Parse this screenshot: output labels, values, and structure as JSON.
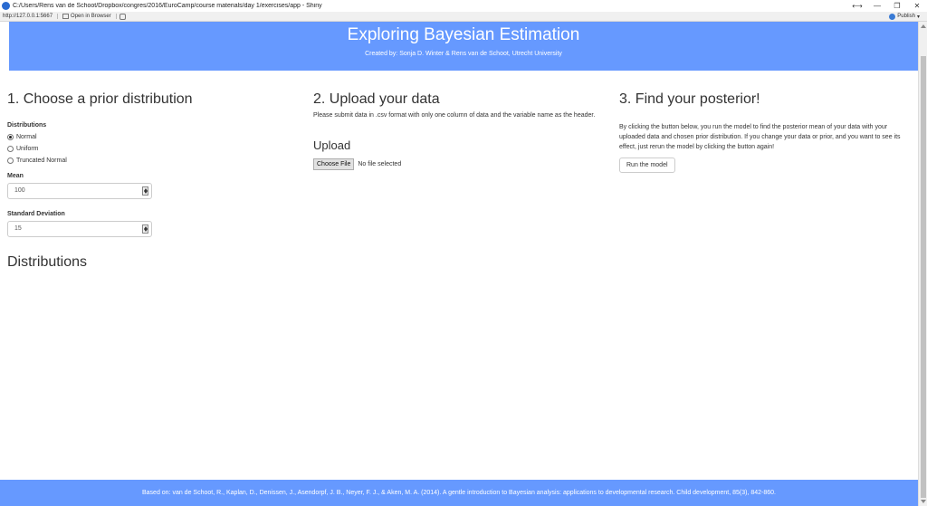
{
  "window": {
    "title": "C:/Users/Rens van de Schoot/Dropbox/congres/2016/EuroCamp/course materials/day 1/exercises/app - Shiny",
    "controls": [
      "⟷",
      "—",
      "❐",
      "✕"
    ]
  },
  "toolbar": {
    "url": "http://127.0.0.1:5667",
    "open_in_browser": "Open in Browser",
    "publish": "Publish",
    "publish_caret": "▾"
  },
  "header": {
    "title": "Exploring Bayesian Estimation",
    "subtitle": "Created by: Sonja D. Winter & Rens van de Schoot, Utrecht University"
  },
  "prior": {
    "heading": "1. Choose a prior distribution",
    "distributions_label": "Distributions",
    "options": [
      {
        "label": "Normal",
        "selected": true
      },
      {
        "label": "Uniform",
        "selected": false
      },
      {
        "label": "Truncated Normal",
        "selected": false
      }
    ],
    "mean_label": "Mean",
    "mean_value": "100",
    "sd_label": "Standard Deviation",
    "sd_value": "15",
    "plot_heading": "Distributions"
  },
  "upload": {
    "heading": "2. Upload your data",
    "instructions": "Please submit data in .csv format with only one column of data and the variable name as the header.",
    "subheading": "Upload",
    "choose_file": "Choose File",
    "file_status": "No file selected"
  },
  "posterior": {
    "heading": "3. Find your posterior!",
    "instructions": "By clicking the button below, you run the model to find the posterior mean of your data with your uploaded data and chosen prior distribution. If you change your data or prior, and you want to see its effect, just rerun the model by clicking the button again!",
    "run_button": "Run the model"
  },
  "footer": {
    "citation": "Based on: van de Schoot, R., Kaplan, D., Denissen, J., Asendorpf, J. B., Neyer, F. J., & Aken, M. A. (2014). A gentle introduction to Bayesian analysis: applications to developmental research. Child development, 85(3), 842-860."
  },
  "colors": {
    "header_bg": "#6699ff",
    "footer_bg": "#6699ff"
  }
}
